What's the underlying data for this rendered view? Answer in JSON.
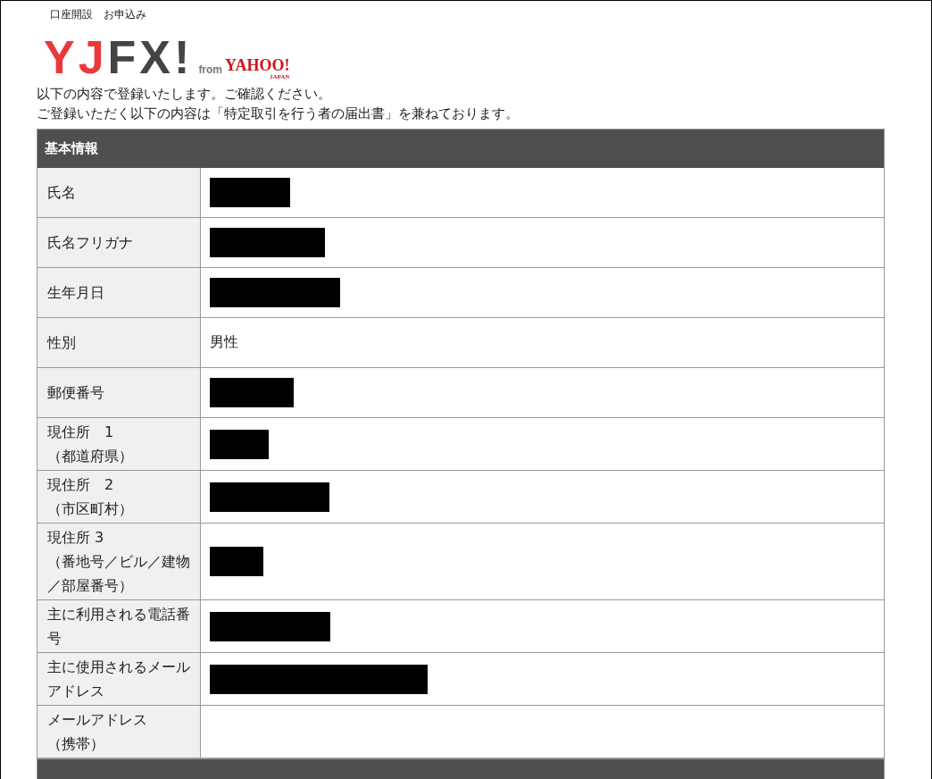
{
  "top_text": "口座開設　お申込み",
  "logo": {
    "mark": "YJ",
    "mark2": "FX!",
    "from": "from",
    "brand": "YAHOO!",
    "region": "JAPAN"
  },
  "intro": [
    "以下の内容で登録いたします。ご確認ください。",
    "ご登録いただく以下の内容は「特定取引を行う者の届出書」を兼ねております。"
  ],
  "sections": [
    {
      "kind": "section",
      "title": "基本情報",
      "rows": [
        {
          "label": [
            "氏名"
          ],
          "kind": "redacted"
        },
        {
          "label": [
            "氏名フリガナ"
          ],
          "kind": "redacted"
        },
        {
          "label": [
            "生年月日"
          ],
          "kind": "redacted"
        },
        {
          "label": [
            "性別"
          ],
          "kind": "text",
          "value": "男性"
        },
        {
          "label": [
            "郵便番号"
          ],
          "kind": "redacted"
        },
        {
          "label": [
            "現住所　1",
            "（都道府県）"
          ],
          "kind": "redacted"
        },
        {
          "label": [
            "現住所　2",
            "（市区町村）"
          ],
          "kind": "redacted"
        },
        {
          "label": [
            "現住所 3",
            "（番地号／ビル／建物／部屋番号）"
          ],
          "kind": "redacted"
        },
        {
          "label": [
            "主に利用される電話番号"
          ],
          "kind": "redacted"
        },
        {
          "label": [
            "主に使用されるメールアドレス"
          ],
          "kind": "redacted"
        },
        {
          "label": [
            "メールアドレス",
            "（携帯）"
          ],
          "kind": "empty"
        }
      ]
    },
    {
      "kind": "section"
    }
  ]
}
